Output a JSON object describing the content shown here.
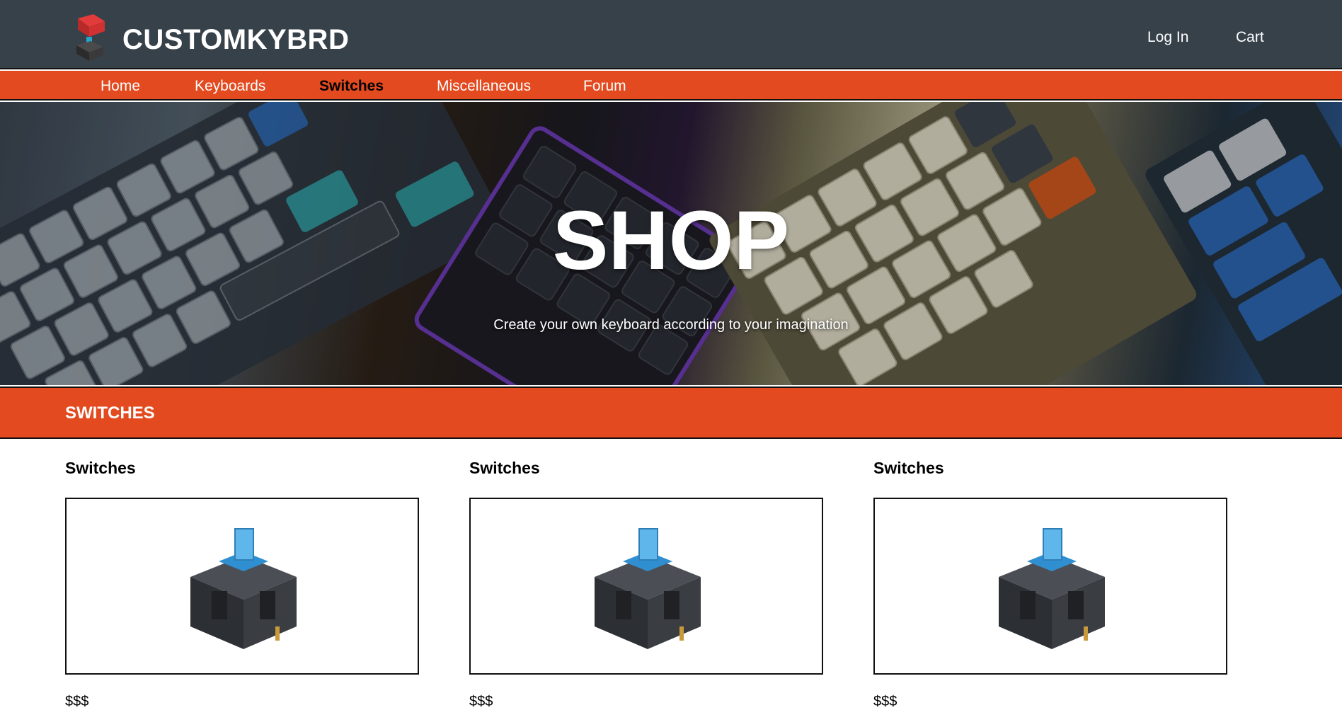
{
  "header": {
    "brand": "CUSTOMKYBRD",
    "logo_icon": "keycap-switch-icon",
    "login_label": "Log In",
    "cart_label": "Cart",
    "background": "#37414a"
  },
  "nav": {
    "items": [
      {
        "label": "Home",
        "active": false
      },
      {
        "label": "Keyboards",
        "active": false
      },
      {
        "label": "Switches",
        "active": true
      },
      {
        "label": "Miscellaneous",
        "active": false
      },
      {
        "label": "Forum",
        "active": false
      }
    ],
    "accent": "#e34a1f"
  },
  "hero": {
    "title": "SHOP",
    "subtitle": "Create your own keyboard according to your imagination",
    "image": "mechanical-keyboards-photo"
  },
  "section": {
    "title": "SWITCHES"
  },
  "products": [
    {
      "name": "Switches",
      "price": "$$$",
      "image": "blue-switch-image"
    },
    {
      "name": "Switches",
      "price": "$$$",
      "image": "blue-switch-image"
    },
    {
      "name": "Switches",
      "price": "$$$",
      "image": "blue-switch-image"
    }
  ]
}
